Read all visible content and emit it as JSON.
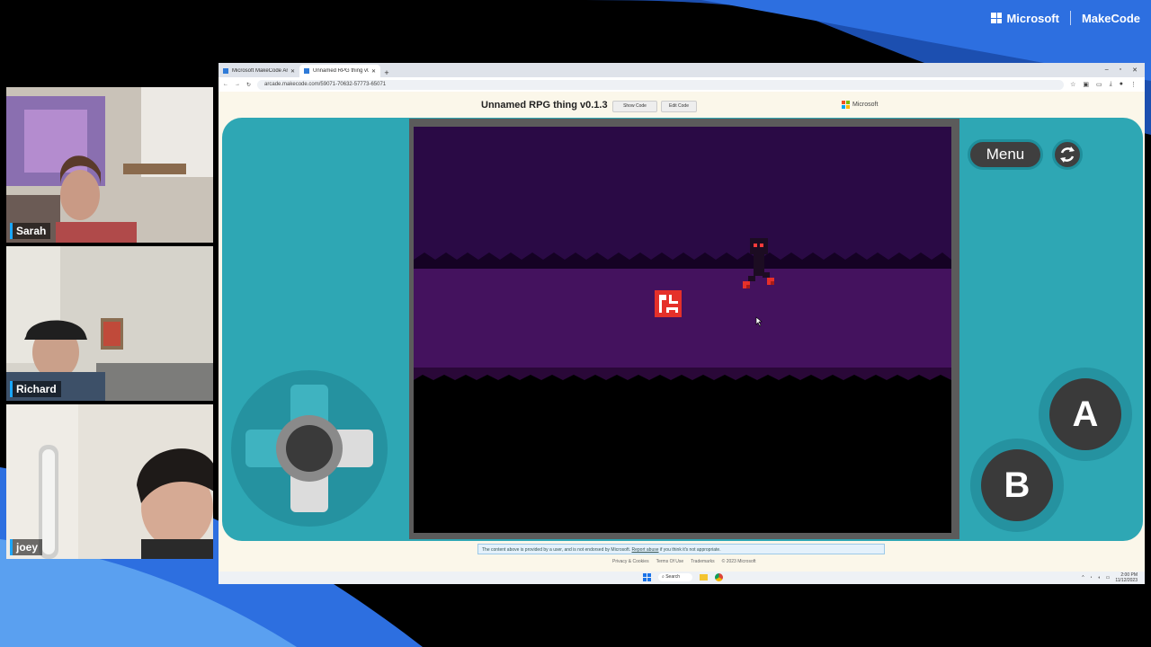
{
  "brand": {
    "microsoft": "Microsoft",
    "makecode": "MakeCode"
  },
  "participants": [
    {
      "name": "Sarah"
    },
    {
      "name": "Richard"
    },
    {
      "name": "joey"
    }
  ],
  "browser": {
    "tabs": [
      {
        "title": "Microsoft MakeCode Arcade",
        "active": false
      },
      {
        "title": "Unnamed RPG thing v0.1.3",
        "active": true
      }
    ],
    "url": "arcade.makecode.com/59071-70632-57773-65071",
    "window_controls": [
      "–",
      "▫",
      "✕"
    ]
  },
  "page": {
    "game_title": "Unnamed RPG thing v0.1.3",
    "show_code": "Show Code",
    "edit_code": "Edit Code",
    "microsoft": "Microsoft",
    "menu_label": "Menu",
    "button_a": "A",
    "button_b": "B",
    "disclaimer_text": "The content above is provided by a user, and is not endorsed by Microsoft.",
    "report_abuse": "Report abuse",
    "disclaimer_tail": "if you think it's not appropriate.",
    "footer_links": [
      "Privacy & Cookies",
      "Terms Of Use",
      "Trademarks",
      "© 2023 Microsoft"
    ]
  },
  "taskbar": {
    "search": "Search",
    "time": "2:00 PM",
    "date": "11/12/2023"
  },
  "colors": {
    "console": "#2ea7b4",
    "game_sky": "#2a0a45",
    "game_floor": "#44125e",
    "accent_blue": "#1a73e8"
  }
}
